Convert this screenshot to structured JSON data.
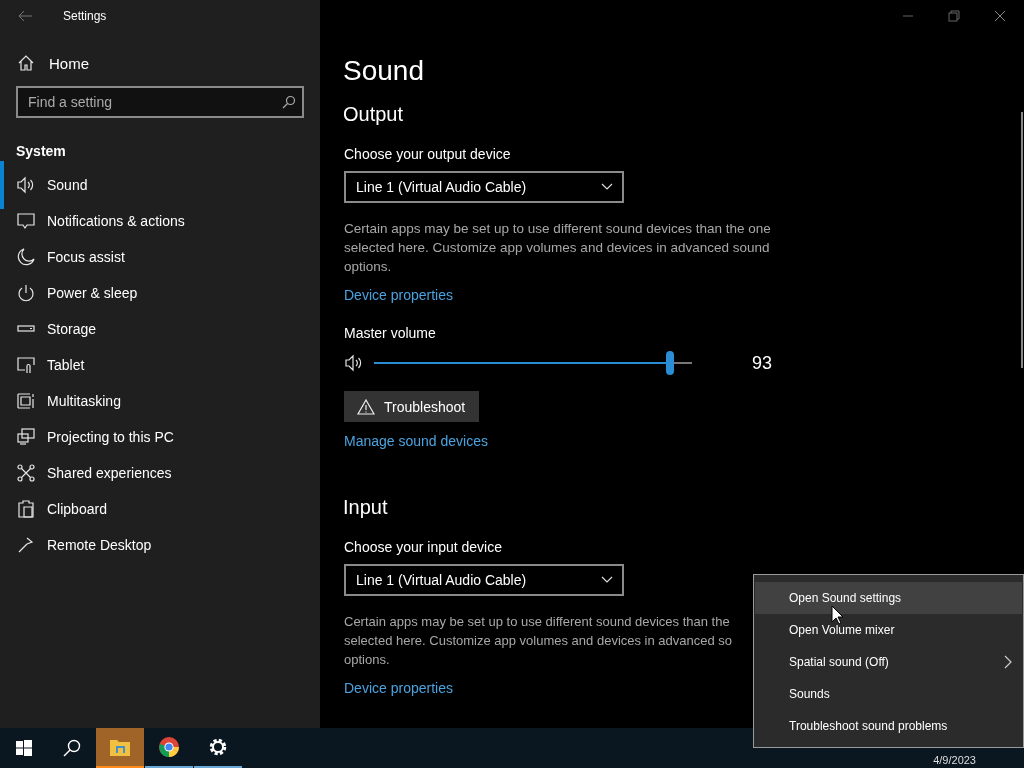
{
  "window": {
    "title": "Settings"
  },
  "sidebar": {
    "home": "Home",
    "search": {
      "placeholder": "Find a setting"
    },
    "section": "System",
    "items": [
      {
        "kind": "sound",
        "label": "Sound",
        "selected": true
      },
      {
        "kind": "notifications",
        "label": "Notifications & actions",
        "selected": false
      },
      {
        "kind": "focus",
        "label": "Focus assist",
        "selected": false
      },
      {
        "kind": "power",
        "label": "Power & sleep",
        "selected": false
      },
      {
        "kind": "storage",
        "label": "Storage",
        "selected": false
      },
      {
        "kind": "tablet",
        "label": "Tablet",
        "selected": false
      },
      {
        "kind": "multitasking",
        "label": "Multitasking",
        "selected": false
      },
      {
        "kind": "projecting",
        "label": "Projecting to this PC",
        "selected": false
      },
      {
        "kind": "shared",
        "label": "Shared experiences",
        "selected": false
      },
      {
        "kind": "clipboard",
        "label": "Clipboard",
        "selected": false
      },
      {
        "kind": "remote",
        "label": "Remote Desktop",
        "selected": false
      }
    ]
  },
  "page": {
    "title": "Sound",
    "output": {
      "heading": "Output",
      "device_label": "Choose your output device",
      "device": "Line 1 (Virtual Audio Cable)",
      "note": "Certain apps may be set up to use different sound devices than the one selected here. Customize app volumes and devices in advanced sound options.",
      "properties_link": "Device properties",
      "volume_label": "Master volume",
      "volume": {
        "level": 0.93,
        "reading": "93"
      },
      "troubleshoot": "Troubleshoot",
      "manage_link": "Manage sound devices"
    },
    "input": {
      "heading": "Input",
      "device_label": "Choose your input device",
      "device": "Line 1 (Virtual Audio Cable)",
      "note_lines": [
        "Certain apps may be set up to use different sound devices than the",
        "selected here. Customize app volumes and devices in advanced so",
        "options."
      ],
      "properties_link": "Device properties"
    }
  },
  "context_menu": {
    "items": [
      {
        "label": "Open Sound settings",
        "selected": true,
        "submenu": false
      },
      {
        "label": "Open Volume mixer",
        "selected": false,
        "submenu": false
      },
      {
        "label": "Spatial sound (Off)",
        "selected": false,
        "submenu": true
      },
      {
        "label": "Sounds",
        "selected": false,
        "submenu": false
      },
      {
        "label": "Troubleshoot sound problems",
        "selected": false,
        "submenu": false
      }
    ]
  },
  "taskbar": {
    "apps": [
      {
        "kind": "explorer",
        "selected": true
      },
      {
        "kind": "chrome",
        "selected": false
      },
      {
        "kind": "settings",
        "selected": false
      }
    ],
    "date": "4/9/2023"
  }
}
